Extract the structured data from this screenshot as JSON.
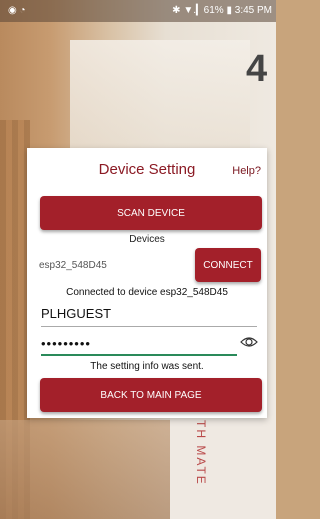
{
  "status_bar": {
    "left_icons": "◉  ◔",
    "right_text": "✱ ▼.▎61% ▮ 3:45 PM"
  },
  "background": {
    "big_number": "4",
    "shirt_text": "TH MATE"
  },
  "dialog": {
    "title": "Device Setting",
    "help_label": "Help?",
    "scan_label": "SCAN DEVICE",
    "devices_label": "Devices",
    "device_name": "esp32_548D45",
    "connect_label": "CONNECT",
    "connected_message": "Connected to device esp32_548D45",
    "ssid_value": "PLHGUEST",
    "password_value": "•••••••••",
    "sent_message": "The setting info was sent.",
    "back_label": "BACK TO MAIN PAGE"
  },
  "colors": {
    "accent": "#a3202a",
    "title": "#8b1a24",
    "input_focus": "#2a8a5a"
  }
}
